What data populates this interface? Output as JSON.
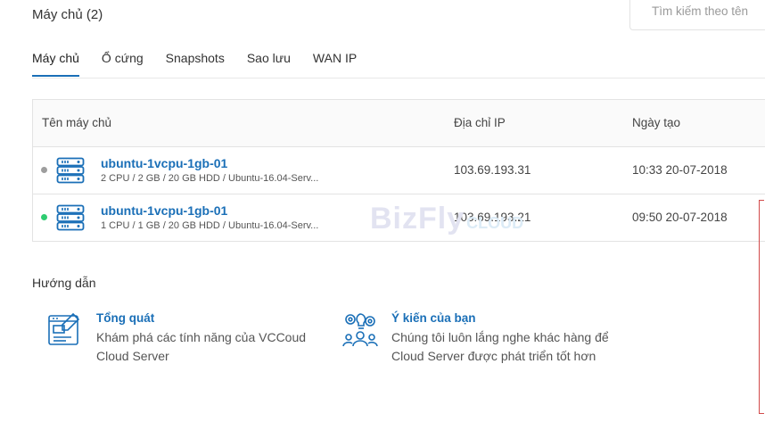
{
  "page": {
    "title": "Máy chủ (2)"
  },
  "search": {
    "placeholder": "Tìm kiếm theo tên"
  },
  "tabs": [
    {
      "label": "Máy chủ",
      "active": true
    },
    {
      "label": "Ổ cứng",
      "active": false
    },
    {
      "label": "Snapshots",
      "active": false
    },
    {
      "label": "Sao lưu",
      "active": false
    },
    {
      "label": "WAN IP",
      "active": false
    }
  ],
  "table": {
    "headers": {
      "name": "Tên máy chủ",
      "ip": "Địa chỉ IP",
      "created": "Ngày tạo"
    },
    "rows": [
      {
        "status_color": "#9e9e9e",
        "name": "ubuntu-1vcpu-1gb-01",
        "spec": "2 CPU / 2 GB / 20 GB HDD / Ubuntu-16.04-Serv...",
        "ip": "103.69.193.31",
        "created": "10:33 20-07-2018"
      },
      {
        "status_color": "#2ecc71",
        "name": "ubuntu-1vcpu-1gb-01",
        "spec": "1 CPU / 1 GB / 20 GB HDD / Ubuntu-16.04-Serv...",
        "ip": "103.69.193.21",
        "created": "09:50 20-07-2018"
      }
    ]
  },
  "watermark": {
    "brand": "BizFly",
    "sub": "CLOUD"
  },
  "guide": {
    "title": "Hướng dẫn",
    "items": [
      {
        "icon": "blueprint-icon",
        "title": "Tổng quát",
        "desc": "Khám phá các tính năng của VCCoud Cloud Server"
      },
      {
        "icon": "feedback-team-icon",
        "title": "Ý kiến của bạn",
        "desc": "Chúng tôi luôn lắng nghe khác hàng để Cloud Server được phát triển tốt hơn"
      }
    ]
  },
  "colors": {
    "accent": "#1a6fb7",
    "status_off": "#9e9e9e",
    "status_on": "#2ecc71"
  }
}
